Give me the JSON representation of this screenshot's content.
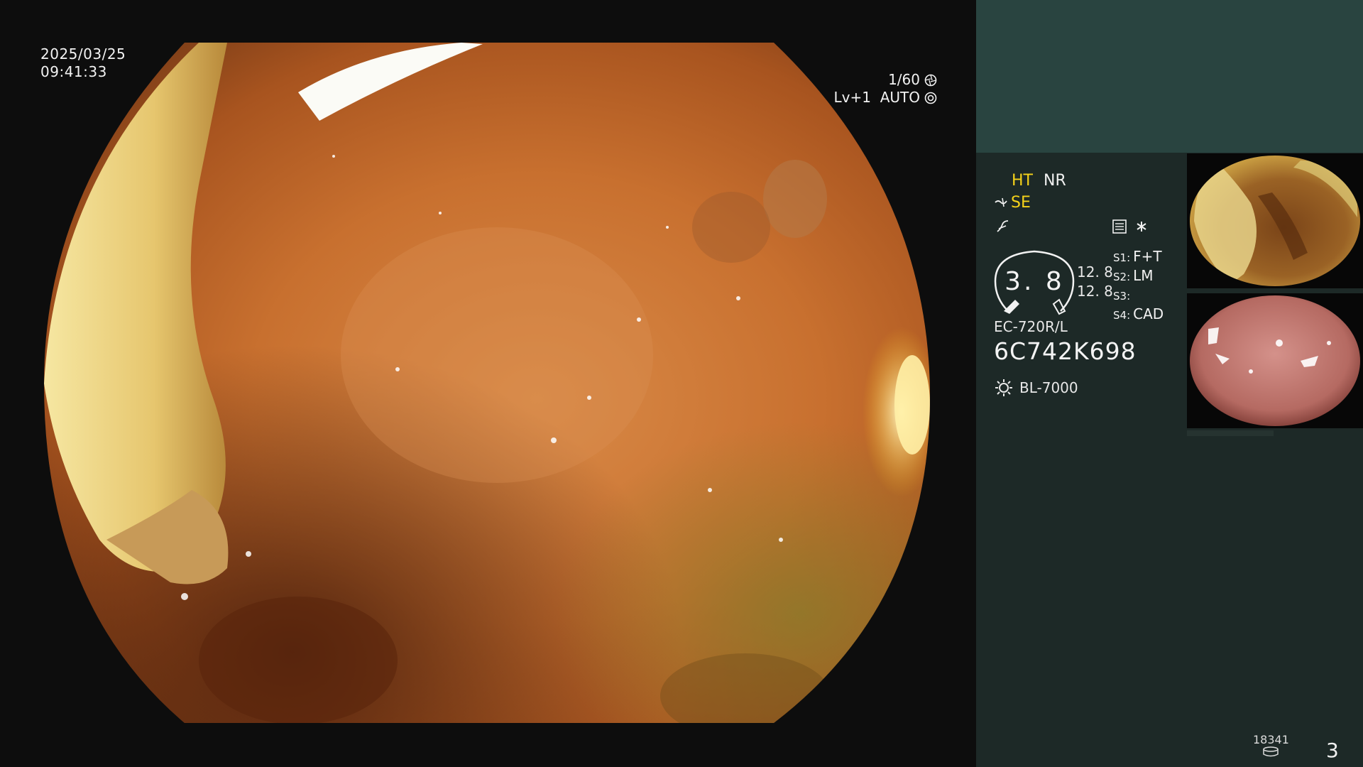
{
  "osd": {
    "date": "2025/03/25",
    "time": "09:41:33",
    "shutter": "1/60",
    "iris": "Lv+1  AUTO"
  },
  "status": {
    "ht": "HT",
    "nr": "NR",
    "se": "SE",
    "gauge_value": "3. 8",
    "values": [
      "12. 8",
      "12. 8"
    ],
    "slots": [
      {
        "key": "S1:",
        "value": "F+T"
      },
      {
        "key": "S2:",
        "value": "LM"
      },
      {
        "key": "S3:",
        "value": ""
      },
      {
        "key": "S4:",
        "value": "CAD"
      }
    ],
    "scope_model": "EC-720R/L",
    "serial": "6C742K698",
    "light_source": "BL-7000"
  },
  "footer": {
    "capture_count": "18341",
    "page_number": "3"
  },
  "colors": {
    "accent_yellow": "#f5d21a",
    "panel_bg": "#1d2927",
    "panel_top": "#294440"
  }
}
